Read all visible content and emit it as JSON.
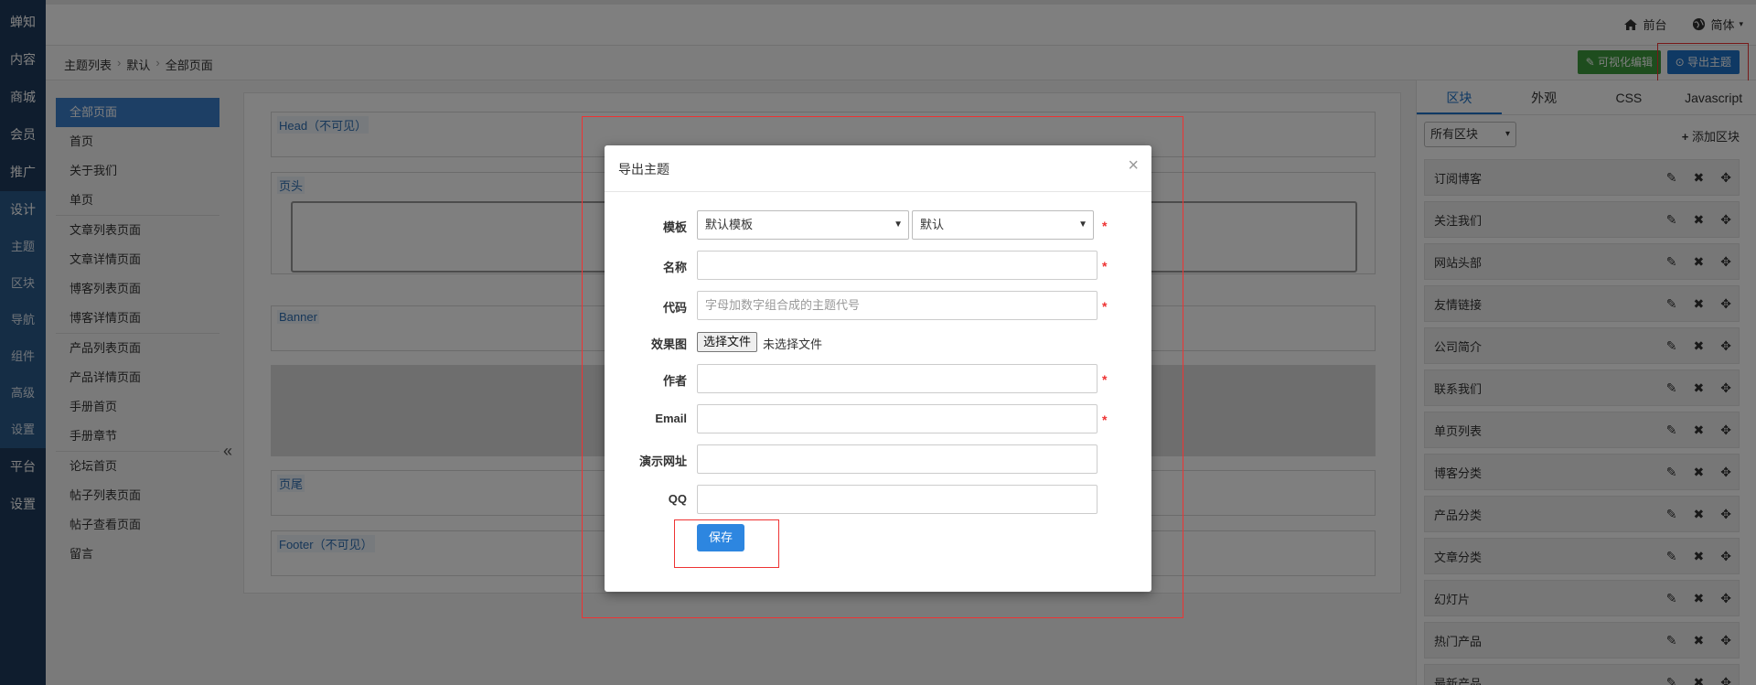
{
  "leftnav": {
    "items": [
      {
        "label": "蝉知"
      },
      {
        "label": "内容"
      },
      {
        "label": "商城"
      },
      {
        "label": "会员"
      },
      {
        "label": "推广"
      },
      {
        "label": "设计"
      },
      {
        "label": "主题"
      },
      {
        "label": "区块"
      },
      {
        "label": "导航"
      },
      {
        "label": "组件"
      },
      {
        "label": "高级"
      },
      {
        "label": "设置"
      },
      {
        "label": "平台"
      },
      {
        "label": "设置"
      }
    ]
  },
  "topbar": {
    "frontend_label": "前台",
    "language_label": "简体"
  },
  "breadcrumb": {
    "items": [
      "主题列表",
      "默认",
      "全部页面"
    ]
  },
  "toolbar": {
    "visual_edit_label": "可视化编辑",
    "export_label": "导出主题"
  },
  "pagelist": {
    "items": [
      "全部页面",
      "首页",
      "关于我们",
      "单页",
      "文章列表页面",
      "文章详情页面",
      "博客列表页面",
      "博客详情页面",
      "产品列表页面",
      "产品详情页面",
      "手册首页",
      "手册章节",
      "论坛首页",
      "帖子列表页面",
      "帖子查看页面",
      "留言"
    ]
  },
  "canvas": {
    "regions": [
      "Head（不可见）",
      "页头",
      "Banner",
      "页尾",
      "Footer（不可见）"
    ]
  },
  "rpanel": {
    "tabs": [
      "区块",
      "外观",
      "CSS",
      "Javascript"
    ],
    "filter_value": "所有区块",
    "add_label": "添加区块",
    "blocks": [
      "订阅博客",
      "关注我们",
      "网站头部",
      "友情链接",
      "公司简介",
      "联系我们",
      "单页列表",
      "博客分类",
      "产品分类",
      "文章分类",
      "幻灯片",
      "热门产品",
      "最新产品"
    ]
  },
  "modal": {
    "title": "导出主题",
    "close_glyph": "×",
    "template_label": "模板",
    "template_value": "默认模板",
    "theme_value": "默认",
    "name_label": "名称",
    "name_value": "",
    "code_label": "代码",
    "code_placeholder": "字母加数字组合成的主题代号",
    "preview_label": "效果图",
    "file_button_label": "选择文件",
    "file_status": "未选择文件",
    "author_label": "作者",
    "author_value": "",
    "email_label": "Email",
    "email_value": "",
    "demo_label": "演示网址",
    "demo_value": "",
    "qq_label": "QQ",
    "qq_value": "",
    "required_mark": "*",
    "save_label": "保存"
  },
  "colors": {
    "nav_bg": "#1f3a5c",
    "accent": "#1e73c8",
    "success": "#3c9a3c",
    "required": "#e33333",
    "highlight_box": "#e33333"
  }
}
